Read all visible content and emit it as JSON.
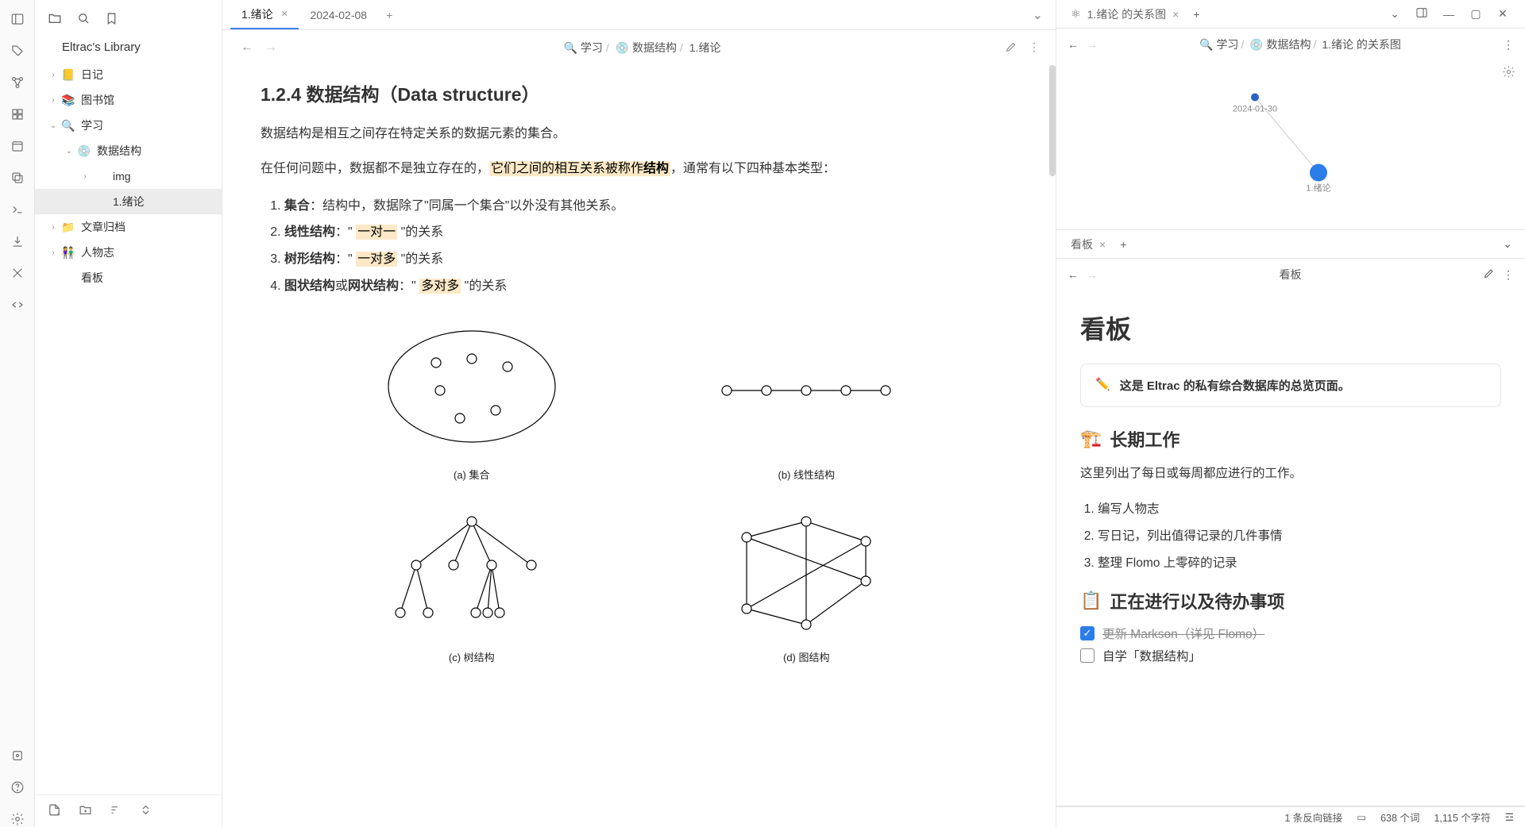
{
  "sidebar": {
    "library_title": "Eltrac's Library",
    "items": [
      {
        "icon": "📒",
        "label": "日记",
        "indent": 0,
        "chev": "›",
        "active": false
      },
      {
        "icon": "📚",
        "label": "图书馆",
        "indent": 0,
        "chev": "›",
        "active": false
      },
      {
        "icon": "🔍",
        "label": "学习",
        "indent": 0,
        "chev": "⌄",
        "active": false
      },
      {
        "icon": "💿",
        "label": "数据结构",
        "indent": 1,
        "chev": "⌄",
        "active": false
      },
      {
        "icon": "",
        "label": "img",
        "indent": 2,
        "chev": "›",
        "active": false
      },
      {
        "icon": "",
        "label": "1.绪论",
        "indent": 2,
        "chev": "",
        "active": true
      },
      {
        "icon": "📁",
        "label": "文章归档",
        "indent": 0,
        "chev": "›",
        "active": false
      },
      {
        "icon": "👫",
        "label": "人物志",
        "indent": 0,
        "chev": "›",
        "active": false
      },
      {
        "icon": "",
        "label": "看板",
        "indent": 0,
        "chev": "",
        "active": false
      }
    ]
  },
  "main": {
    "tabs": [
      {
        "title": "1.绪论",
        "active": true,
        "closable": true
      },
      {
        "title": "2024-02-08",
        "active": false,
        "closable": false
      }
    ],
    "crumb": {
      "a": "🔍 学习",
      "b": "💿 数据结构",
      "c": "1.绪论"
    },
    "heading": "1.2.4 数据结构（Data structure）",
    "para1": "数据结构是相互之间存在特定关系的数据元素的集合。",
    "para2a": "在任何问题中，数据都不是独立存在的，",
    "para2hl": "它们之间的相互关系被称作",
    "para2bold": "结构",
    "para2b": "，通常有以下四种基本类型：",
    "list": [
      {
        "term": "集合",
        "rest": "：结构中，数据除了\"同属一个集合\"以外没有其他关系。"
      },
      {
        "term": "线性结构",
        "rest_a": "：\" ",
        "hl": "一对一",
        "rest_b": " \"的关系"
      },
      {
        "term": "树形结构",
        "rest_a": "：\" ",
        "hl": "一对多",
        "rest_b": " \"的关系"
      },
      {
        "term": "图状结构",
        "mid": "或",
        "term2": "网状结构",
        "rest_a": "：\" ",
        "hl": "多对多",
        "rest_b": " \"的关系"
      }
    ],
    "dia_labels": {
      "a": "(a) 集合",
      "b": "(b) 线性结构",
      "c": "(c) 树结构",
      "d": "(d) 图结构"
    }
  },
  "graph_pane": {
    "tab_icon": "⚛",
    "tab_title": "1.绪论 的关系图",
    "crumb": {
      "a": "🔍 学习",
      "b": "💿 数据结构",
      "c": "1.绪论 的关系图"
    },
    "nodes": {
      "n1": "2024-01-30",
      "n2": "1.绪论"
    }
  },
  "kanban_pane": {
    "tab_title": "看板",
    "crumb_title": "看板",
    "h1": "看板",
    "callout_icon": "✏️",
    "callout_text": "这是 Eltrac 的私有综合数据库的总览页面。",
    "h2a_icon": "🏗️",
    "h2a": "长期工作",
    "p1": "这里列出了每日或每周都应进行的工作。",
    "tasks": [
      "编写人物志",
      "写日记，列出值得记录的几件事情",
      "整理 Flomo 上零碎的记录"
    ],
    "h2b_icon": "📋",
    "h2b": "正在进行以及待办事项",
    "todos": [
      {
        "checked": true,
        "text": "更新 Markson（详见 Flomo）"
      },
      {
        "checked": false,
        "text": "自学「数据结构」"
      }
    ]
  },
  "status": {
    "backlinks": "1 条反向链接",
    "words": "638 个词",
    "chars": "1,115 个字符"
  }
}
